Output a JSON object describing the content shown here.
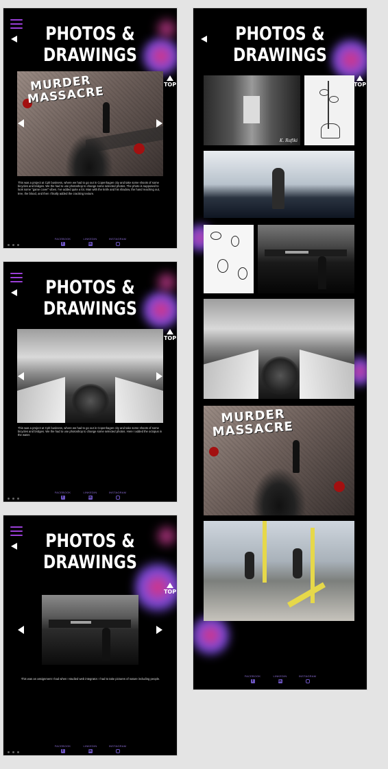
{
  "site": {
    "title_line1": "PHOTOS &",
    "title_line2": "DRAWINGS",
    "top_label": "TOP"
  },
  "slides": [
    {
      "caption": "This was a project at Cph business, where we had to go out in Copenhagen city and take some shoots of some bicycles and bridges. We the had to use photoshop to change some selected photos. The photo is supposed to look some \"game cover\" vibes. I've added quite a lot. Man with the knife and his shadow, the hand reaching out, tree, the blood, and then I finally added the cracking texture.",
      "watermark_line1": "MURDER",
      "watermark_line2": "MASSACRE"
    },
    {
      "caption": "This was a project at Cph business, where we had to go out in Copenhagen city and take some shoots of some bicycles and bridges. We the had to use photoshop to change some selected photos. Here I added the octopus in the water."
    },
    {
      "caption": "This was an assignment I had when I studied web integrator. I had to take pictures of nature including people."
    }
  ],
  "gallery": {
    "watermark_line1": "MURDER",
    "watermark_line2": "MASSACRE",
    "signature": "K. Rafiki"
  },
  "footer": {
    "facebook": "FACEBOOK",
    "linkedin": "LINKEDIN",
    "instagram": "INSTAGRAM",
    "facebook_glyph": "f",
    "linkedin_glyph": "in"
  },
  "icons": {
    "menu": "hamburger-icon",
    "back": "back-arrow-icon",
    "top": "arrow-up-icon",
    "prev": "arrow-left-icon",
    "next": "arrow-right-icon",
    "facebook": "facebook-icon",
    "linkedin": "linkedin-icon",
    "instagram": "instagram-icon"
  },
  "colors": {
    "background": "#000000",
    "canvas": "#e4e4e4",
    "menu_accent": "#9b3fd8",
    "social_accent": "#8e6fd8",
    "splash_pink": "#e0307a",
    "splash_purple": "#7a4de0"
  }
}
